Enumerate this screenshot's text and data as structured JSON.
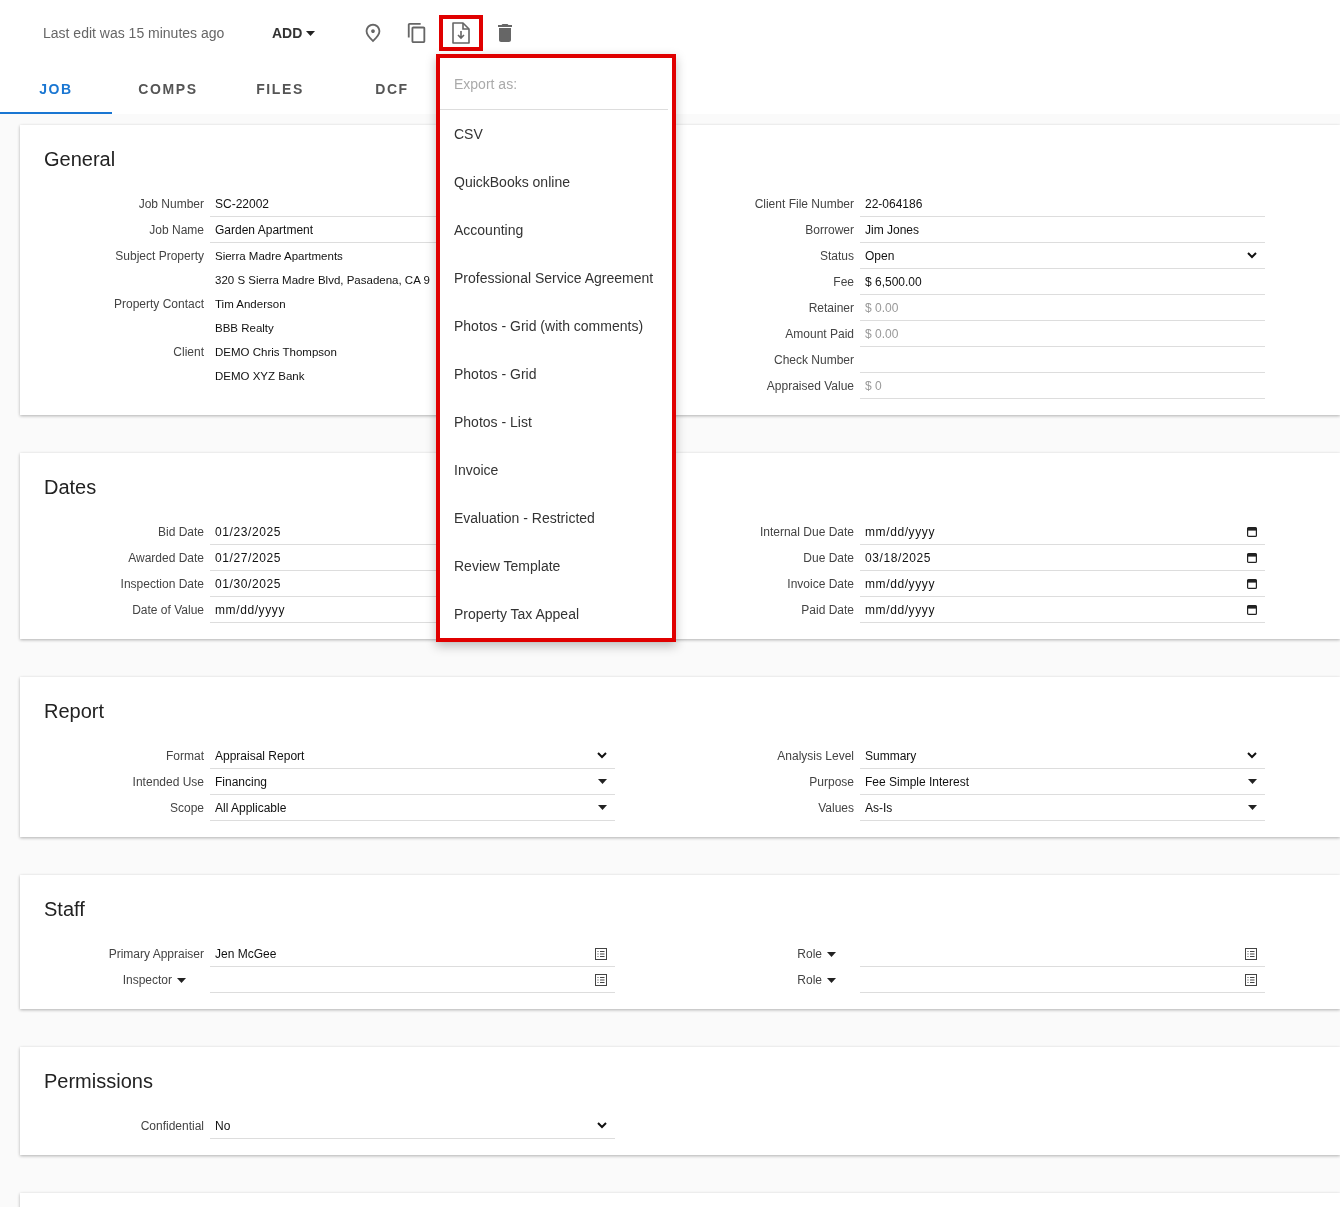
{
  "toolbar": {
    "last_edit": "Last edit was 15 minutes ago",
    "add_button": "ADD"
  },
  "tabs": [
    {
      "label": "JOB",
      "selected": true
    },
    {
      "label": "COMPS",
      "selected": false
    },
    {
      "label": "FILES",
      "selected": false
    },
    {
      "label": "DCF",
      "selected": false
    }
  ],
  "export_menu": {
    "header": "Export as:",
    "items": [
      "CSV",
      "QuickBooks online",
      "Accounting",
      "Professional Service Agreement",
      "Photos - Grid (with comments)",
      "Photos - Grid",
      "Photos - List",
      "Invoice",
      "Evaluation - Restricted",
      "Review Template",
      "Property Tax Appeal"
    ]
  },
  "sections": [
    {
      "title": "General",
      "left": [
        {
          "label": "Job Number",
          "label_dropdown": false,
          "kind": "text",
          "value": "SC-22002"
        },
        {
          "label": "Job Name",
          "label_dropdown": false,
          "kind": "text",
          "value": "Garden Apartment"
        },
        {
          "label": "Subject Property",
          "label_dropdown": false,
          "kind": "multiline",
          "lines": [
            "Sierra Madre Apartments",
            "320 S Sierra Madre Blvd, Pasadena, CA 9"
          ]
        },
        {
          "label": "Property Contact",
          "label_dropdown": false,
          "kind": "multiline",
          "lines": [
            "Tim Anderson",
            "BBB Realty"
          ]
        },
        {
          "label": "Client",
          "label_dropdown": false,
          "kind": "multiline",
          "lines": [
            "DEMO Chris Thompson",
            "DEMO XYZ Bank"
          ]
        }
      ],
      "right": [
        {
          "label": "Client File Number",
          "label_dropdown": false,
          "kind": "text",
          "value": "22-064186"
        },
        {
          "label": "Borrower",
          "label_dropdown": false,
          "kind": "text",
          "value": "Jim Jones"
        },
        {
          "label": "Status",
          "label_dropdown": false,
          "kind": "select",
          "value": "Open"
        },
        {
          "label": "Fee",
          "label_dropdown": false,
          "kind": "text",
          "value": "$ 6,500.00"
        },
        {
          "label": "Retainer",
          "label_dropdown": false,
          "kind": "text",
          "placeholder": "$ 0.00"
        },
        {
          "label": "Amount Paid",
          "label_dropdown": false,
          "kind": "text",
          "placeholder": "$ 0.00"
        },
        {
          "label": "Check Number",
          "label_dropdown": false,
          "kind": "text"
        },
        {
          "label": "Appraised Value",
          "label_dropdown": false,
          "kind": "text",
          "placeholder": "$ 0"
        }
      ]
    },
    {
      "title": "Dates",
      "left": [
        {
          "label": "Bid Date",
          "label_dropdown": false,
          "kind": "date",
          "value": "01/23/2025"
        },
        {
          "label": "Awarded Date",
          "label_dropdown": false,
          "kind": "date",
          "value": "01/27/2025"
        },
        {
          "label": "Inspection Date",
          "label_dropdown": false,
          "kind": "date",
          "value": "01/30/2025"
        },
        {
          "label": "Date of Value",
          "label_dropdown": false,
          "kind": "date",
          "value": "mm/dd/yyyy"
        }
      ],
      "right": [
        {
          "label": "Internal Due Date",
          "label_dropdown": false,
          "kind": "date",
          "value": "mm/dd/yyyy"
        },
        {
          "label": "Due Date",
          "label_dropdown": false,
          "kind": "date",
          "value": "03/18/2025"
        },
        {
          "label": "Invoice Date",
          "label_dropdown": false,
          "kind": "date",
          "value": "mm/dd/yyyy"
        },
        {
          "label": "Paid Date",
          "label_dropdown": false,
          "kind": "date",
          "value": "mm/dd/yyyy"
        }
      ]
    },
    {
      "title": "Report",
      "left": [
        {
          "label": "Format",
          "label_dropdown": false,
          "kind": "select",
          "value": "Appraisal Report"
        },
        {
          "label": "Intended Use",
          "label_dropdown": false,
          "kind": "dropdown",
          "value": "Financing"
        },
        {
          "label": "Scope",
          "label_dropdown": false,
          "kind": "dropdown",
          "value": "All Applicable"
        }
      ],
      "right": [
        {
          "label": "Analysis Level",
          "label_dropdown": false,
          "kind": "select",
          "value": "Summary"
        },
        {
          "label": "Purpose",
          "label_dropdown": false,
          "kind": "dropdown",
          "value": "Fee Simple Interest"
        },
        {
          "label": "Values",
          "label_dropdown": false,
          "kind": "dropdown",
          "value": "As-Is"
        }
      ]
    },
    {
      "title": "Staff",
      "left": [
        {
          "label": "Primary Appraiser",
          "label_dropdown": false,
          "kind": "lookup",
          "value": "Jen McGee"
        },
        {
          "label": "Inspector",
          "label_dropdown": true,
          "kind": "lookup"
        }
      ],
      "right": [
        {
          "label": "Role",
          "label_dropdown": true,
          "kind": "lookup"
        },
        {
          "label": "Role",
          "label_dropdown": true,
          "kind": "lookup"
        }
      ]
    },
    {
      "title": "Permissions",
      "left": [
        {
          "label": "Confidential",
          "label_dropdown": false,
          "kind": "select",
          "value": "No"
        }
      ]
    }
  ]
}
